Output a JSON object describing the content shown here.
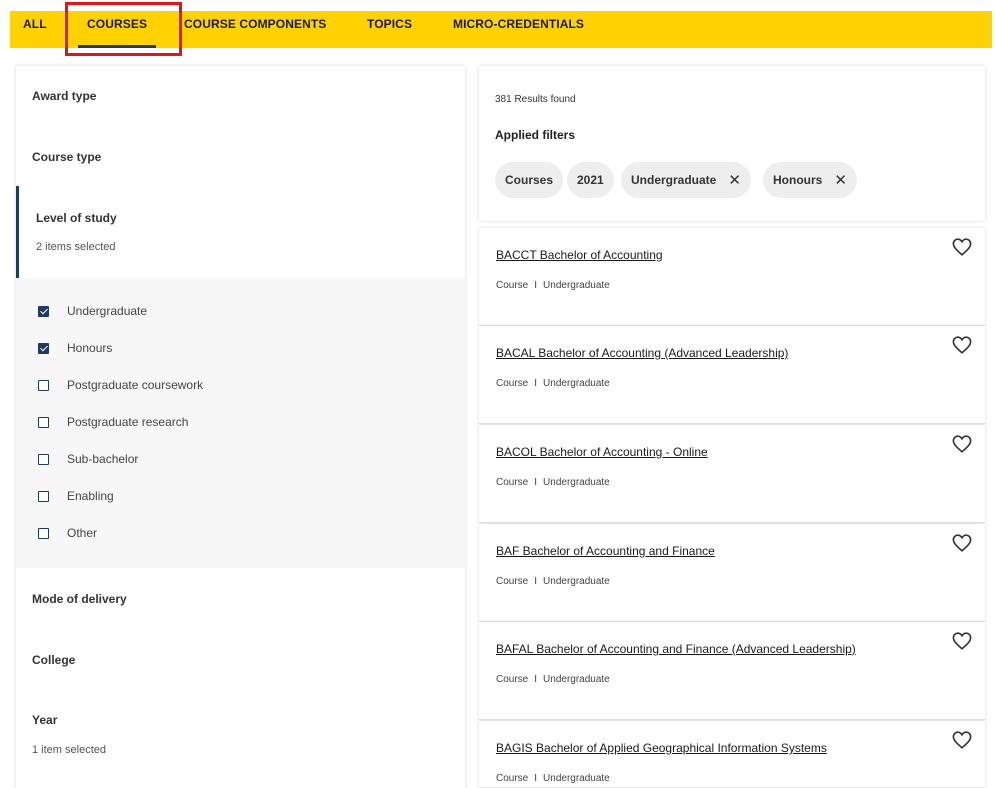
{
  "tabs": [
    {
      "label": "ALL",
      "active": false
    },
    {
      "label": "COURSES",
      "active": true
    },
    {
      "label": "COURSE COMPONENTS",
      "active": false
    },
    {
      "label": "TOPICS",
      "active": false
    },
    {
      "label": "MICRO-CREDENTIALS",
      "active": false
    }
  ],
  "filters": {
    "award_type": "Award type",
    "course_type": "Course type",
    "level_of_study": {
      "title": "Level of study",
      "selected_note": "2 items selected",
      "options": [
        {
          "label": "Undergraduate",
          "checked": true
        },
        {
          "label": "Honours",
          "checked": true
        },
        {
          "label": "Postgraduate coursework",
          "checked": false
        },
        {
          "label": "Postgraduate research",
          "checked": false
        },
        {
          "label": "Sub-bachelor",
          "checked": false
        },
        {
          "label": "Enabling",
          "checked": false
        },
        {
          "label": "Other",
          "checked": false
        }
      ]
    },
    "mode_of_delivery": "Mode of delivery",
    "college": "College",
    "year": {
      "title": "Year",
      "selected_note": "1 item selected"
    }
  },
  "results_header": {
    "count_text": "381 Results found",
    "applied_label": "Applied filters",
    "chips": [
      {
        "label": "Courses",
        "removable": false
      },
      {
        "label": "2021",
        "removable": false
      },
      {
        "label": "Undergraduate",
        "removable": true
      },
      {
        "label": "Honours",
        "removable": true
      }
    ],
    "remove_glyph": "✕"
  },
  "results": [
    {
      "name": "BACCT Bachelor of Accounting",
      "type": "Course",
      "separator": "I",
      "level": "Undergraduate"
    },
    {
      "name": "BACAL Bachelor of Accounting (Advanced Leadership)",
      "type": "Course",
      "separator": "I",
      "level": "Undergraduate"
    },
    {
      "name": "BACOL Bachelor of Accounting - Online",
      "type": "Course",
      "separator": "I",
      "level": "Undergraduate"
    },
    {
      "name": "BAF Bachelor of Accounting and Finance",
      "type": "Course",
      "separator": "I",
      "level": "Undergraduate"
    },
    {
      "name": "BAFAL Bachelor of Accounting and Finance (Advanced Leadership)",
      "type": "Course",
      "separator": "I",
      "level": "Undergraduate"
    },
    {
      "name": "BAGIS Bachelor of Applied Geographical Information Systems",
      "type": "Course",
      "separator": "I",
      "level": "Undergraduate"
    }
  ],
  "colors": {
    "tabbar": "#ffd200",
    "accent": "#1f3a5f",
    "highlight": "#e0141b"
  },
  "icons": {
    "favorite": "heart-outline-icon",
    "remove": "close-icon",
    "checkbox": "checkbox-icon"
  }
}
